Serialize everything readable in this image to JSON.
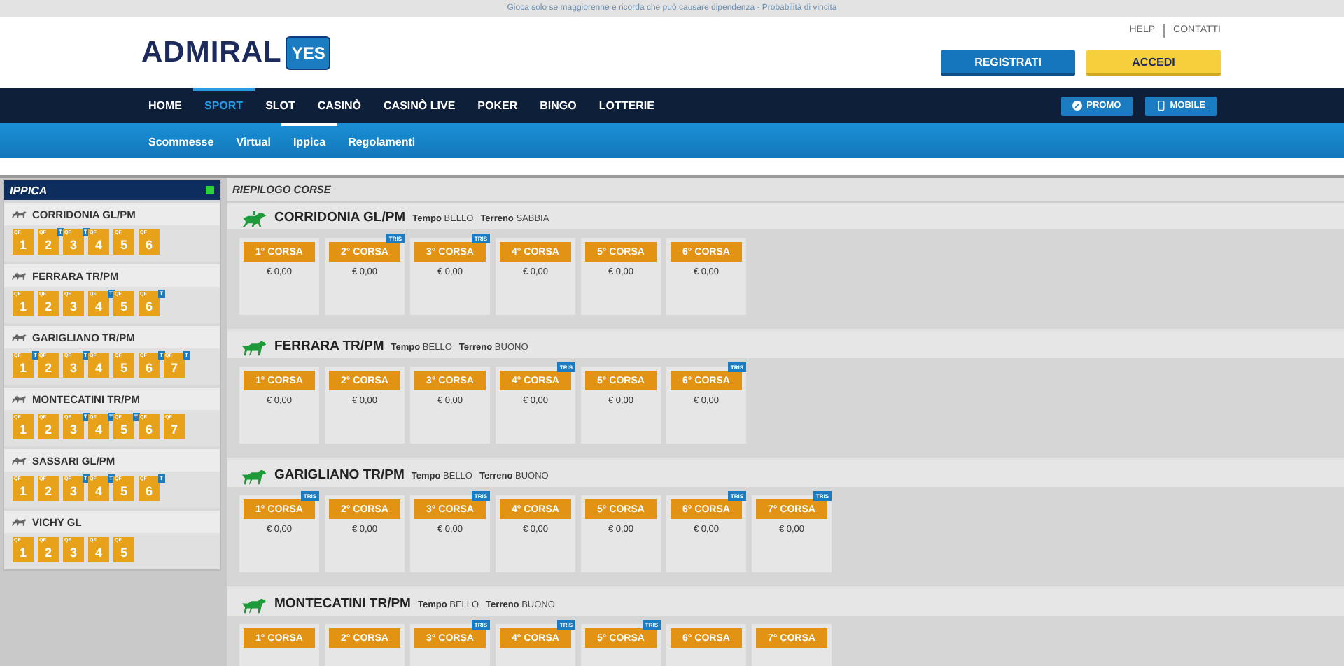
{
  "notice": "Gioca solo se maggiorenne e ricorda che può causare dipendenza - Probabilità di vincita",
  "header": {
    "logo": "ADMIRAL",
    "logo_badge": "YES",
    "links": [
      "HELP",
      "CONTATTI"
    ],
    "buttons": [
      {
        "label": "REGISTRATI",
        "kind": "primary"
      },
      {
        "label": "ACCEDI",
        "kind": "accent"
      }
    ]
  },
  "nav": {
    "items": [
      {
        "label": "HOME",
        "selected": false
      },
      {
        "label": "SPORT",
        "selected": true
      },
      {
        "label": "SLOT",
        "selected": false
      },
      {
        "label": "CASINÒ",
        "selected": false
      },
      {
        "label": "CASINÒ LIVE",
        "selected": false
      },
      {
        "label": "POKER",
        "selected": false
      },
      {
        "label": "BINGO",
        "selected": false
      },
      {
        "label": "LOTTERIE",
        "selected": false
      }
    ],
    "actions": [
      {
        "label": "PROMO",
        "kind": "promo"
      },
      {
        "label": "MOBILE",
        "kind": "mobile"
      }
    ]
  },
  "subnav": [
    {
      "label": "Scommesse",
      "selected": false
    },
    {
      "label": "Virtual",
      "selected": false
    },
    {
      "label": "Ippica",
      "selected": true
    },
    {
      "label": "Regolamenti",
      "selected": false
    }
  ],
  "sidebar": {
    "title": "IPPICA",
    "meetings": [
      {
        "name": "CORRIDONIA GL/PM",
        "races": [
          {
            "number": "1",
            "tag": "QF"
          },
          {
            "number": "2",
            "tag": "QF",
            "badge": "T"
          },
          {
            "number": "3",
            "tag": "QF",
            "badge": "T"
          },
          {
            "number": "4",
            "tag": "QF"
          },
          {
            "number": "5",
            "tag": "QF"
          },
          {
            "number": "6",
            "tag": "QF"
          }
        ]
      },
      {
        "name": "FERRARA TR/PM",
        "races": [
          {
            "number": "1",
            "tag": "QF"
          },
          {
            "number": "2",
            "tag": "QF"
          },
          {
            "number": "3",
            "tag": "QF"
          },
          {
            "number": "4",
            "tag": "QF",
            "badge": "T"
          },
          {
            "number": "5",
            "tag": "QF"
          },
          {
            "number": "6",
            "tag": "QF",
            "badge": "T"
          }
        ]
      },
      {
        "name": "GARIGLIANO TR/PM",
        "races": [
          {
            "number": "1",
            "tag": "QF",
            "badge": "T"
          },
          {
            "number": "2",
            "tag": "QF"
          },
          {
            "number": "3",
            "tag": "QF",
            "badge": "T"
          },
          {
            "number": "4",
            "tag": "QF"
          },
          {
            "number": "5",
            "tag": "QF"
          },
          {
            "number": "6",
            "tag": "QF",
            "badge": "T"
          },
          {
            "number": "7",
            "tag": "QF",
            "badge": "T"
          }
        ]
      },
      {
        "name": "MONTECATINI TR/PM",
        "races": [
          {
            "number": "1",
            "tag": "QF"
          },
          {
            "number": "2",
            "tag": "QF"
          },
          {
            "number": "3",
            "tag": "QF",
            "badge": "T"
          },
          {
            "number": "4",
            "tag": "QF",
            "badge": "T"
          },
          {
            "number": "5",
            "tag": "QF",
            "badge": "T"
          },
          {
            "number": "6",
            "tag": "QF"
          },
          {
            "number": "7",
            "tag": "QF"
          }
        ]
      },
      {
        "name": "SASSARI GL/PM",
        "races": [
          {
            "number": "1",
            "tag": "QF"
          },
          {
            "number": "2",
            "tag": "QF"
          },
          {
            "number": "3",
            "tag": "QF",
            "badge": "T"
          },
          {
            "number": "4",
            "tag": "QF",
            "badge": "T"
          },
          {
            "number": "5",
            "tag": "QF"
          },
          {
            "number": "6",
            "tag": "QF",
            "badge": "T"
          }
        ]
      },
      {
        "name": "VICHY GL",
        "races": [
          {
            "number": "1",
            "tag": "QF"
          },
          {
            "number": "2",
            "tag": "QF"
          },
          {
            "number": "3",
            "tag": "QF"
          },
          {
            "number": "4",
            "tag": "QF"
          },
          {
            "number": "5",
            "tag": "QF"
          }
        ]
      }
    ]
  },
  "summary": {
    "title": "RIEPILOGO CORSE",
    "meetings": [
      {
        "name": "CORRIDONIA GL/PM",
        "kind": "gallop",
        "weather_label": "Tempo",
        "weather": "BELLO",
        "ground_label": "Terreno",
        "ground": "SABBIA",
        "races": [
          {
            "label": "1° CORSA",
            "amount": "€ 0,00"
          },
          {
            "label": "2° CORSA",
            "amount": "€ 0,00",
            "badge": "TRIS"
          },
          {
            "label": "3° CORSA",
            "amount": "€ 0,00",
            "badge": "TRIS"
          },
          {
            "label": "4° CORSA",
            "amount": "€ 0,00"
          },
          {
            "label": "5° CORSA",
            "amount": "€ 0,00"
          },
          {
            "label": "6° CORSA",
            "amount": "€ 0,00"
          }
        ]
      },
      {
        "name": "FERRARA TR/PM",
        "kind": "trot",
        "weather_label": "Tempo",
        "weather": "BELLO",
        "ground_label": "Terreno",
        "ground": "BUONO",
        "races": [
          {
            "label": "1° CORSA",
            "amount": "€ 0,00"
          },
          {
            "label": "2° CORSA",
            "amount": "€ 0,00"
          },
          {
            "label": "3° CORSA",
            "amount": "€ 0,00"
          },
          {
            "label": "4° CORSA",
            "amount": "€ 0,00",
            "badge": "TRIS"
          },
          {
            "label": "5° CORSA",
            "amount": "€ 0,00"
          },
          {
            "label": "6° CORSA",
            "amount": "€ 0,00",
            "badge": "TRIS"
          }
        ]
      },
      {
        "name": "GARIGLIANO TR/PM",
        "kind": "trot",
        "weather_label": "Tempo",
        "weather": "BELLO",
        "ground_label": "Terreno",
        "ground": "BUONO",
        "races": [
          {
            "label": "1° CORSA",
            "amount": "€ 0,00",
            "badge": "TRIS"
          },
          {
            "label": "2° CORSA",
            "amount": "€ 0,00"
          },
          {
            "label": "3° CORSA",
            "amount": "€ 0,00",
            "badge": "TRIS"
          },
          {
            "label": "4° CORSA",
            "amount": "€ 0,00"
          },
          {
            "label": "5° CORSA",
            "amount": "€ 0,00"
          },
          {
            "label": "6° CORSA",
            "amount": "€ 0,00",
            "badge": "TRIS"
          },
          {
            "label": "7° CORSA",
            "amount": "€ 0,00",
            "badge": "TRIS"
          }
        ]
      },
      {
        "name": "MONTECATINI TR/PM",
        "kind": "trot",
        "weather_label": "Tempo",
        "weather": "BELLO",
        "ground_label": "Terreno",
        "ground": "BUONO",
        "races": [
          {
            "label": "1° CORSA"
          },
          {
            "label": "2° CORSA"
          },
          {
            "label": "3° CORSA",
            "badge": "TRIS"
          },
          {
            "label": "4° CORSA",
            "badge": "TRIS"
          },
          {
            "label": "5° CORSA",
            "badge": "TRIS"
          },
          {
            "label": "6° CORSA"
          },
          {
            "label": "7° CORSA"
          }
        ]
      }
    ]
  }
}
